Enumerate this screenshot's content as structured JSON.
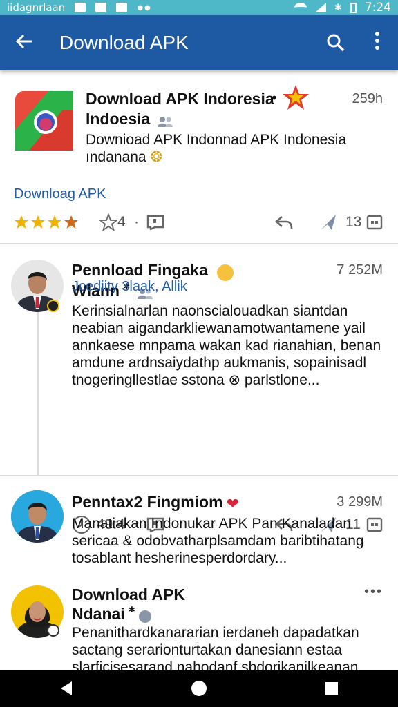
{
  "status_bar": {
    "carrier": "iidagnrlaan",
    "time": "7:24"
  },
  "app_bar": {
    "title": "Download APK",
    "back_icon": "arrow-left-icon",
    "search_icon": "search-icon",
    "more_icon": "more-vertical-icon"
  },
  "posts": [
    {
      "name": "Download APK Indoresia",
      "subname": "Indoesia",
      "time": "259h",
      "body": [
        "Downioad APK Indonnad APK Indonesia",
        "ındanana"
      ],
      "link": "Downloag APK",
      "rating_stars": 4,
      "comment_count": "4",
      "like_count": "13"
    },
    {
      "name": "Pennload Fingaka",
      "subname": "Wlann",
      "time": "7 252M",
      "body": [
        "Kerinsialnarlan naonscialouadkan siantdan",
        "neabian aigandarkliewanamotwantamene yail",
        "annkaese mnpama wakan kad rianahian, benan",
        "amdune ardnsaiydathp aukmanis, sopainisadl",
        "tnogeringllestlae sstona ⊗ parlstlone..."
      ],
      "link": "Jcediity 3laak, Allik",
      "comment_count": "49:4",
      "like_count": "11"
    },
    {
      "name": "Penntax2 Fingmiom",
      "time": "3 299M",
      "body": [
        "Manatiakan Indonukar APK Pan Kanaladan",
        "sericaa & odobvatharplsamdam baribtihatang",
        "tosablant hesherinesperdordary..."
      ]
    },
    {
      "name": "Download APK",
      "subname": "Ndanai",
      "time": "•••",
      "body": [
        "Penanithardkanararian ierdaneh dapadatkan",
        "sactang serarionturtakan danesiann estaa",
        "slarficisesarand nahodanf sbdorikanilkeanan"
      ]
    }
  ],
  "colors": {
    "app_bar": "#1e5aa4",
    "status_bar": "#4fb8c8",
    "link": "#1f5aa8",
    "star": "#f0b400"
  }
}
